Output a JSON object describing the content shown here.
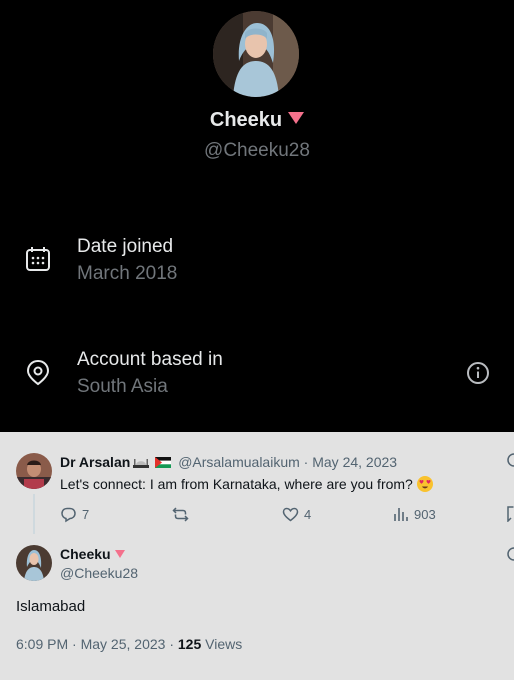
{
  "profile": {
    "name": "Cheeku",
    "handle": "@Cheeku28",
    "date_joined_label": "Date joined",
    "date_joined_value": "March 2018",
    "based_label": "Account based in",
    "based_value": "South Asia",
    "icons": {
      "calendar": "calendar-icon",
      "location": "location-pin-icon",
      "info": "info-icon",
      "badge": "pink-triangle-icon"
    }
  },
  "tweet": {
    "author": "Dr Arsalan",
    "handle": "@Arsalamualaikum",
    "sep": "·",
    "date": "May 24, 2023",
    "text": "Let's connect: I am from Karnataka, where are you from?",
    "replies": "7",
    "likes": "4",
    "views": "903",
    "icons": {
      "reply": "reply-icon",
      "retweet": "retweet-icon",
      "like": "heart-icon",
      "views": "analytics-icon",
      "bookmark": "bookmark-icon"
    }
  },
  "reply": {
    "author": "Cheeku",
    "handle": "@Cheeku28",
    "text": "Islamabad",
    "time": "6:09 PM",
    "sep": "·",
    "date": "May 25, 2023",
    "sep2": "·",
    "views_count": "125",
    "views_label": "Views"
  },
  "colors": {
    "accent_pink": "#f4718c",
    "muted": "#71767b",
    "light_bg": "#e2e2e2"
  }
}
